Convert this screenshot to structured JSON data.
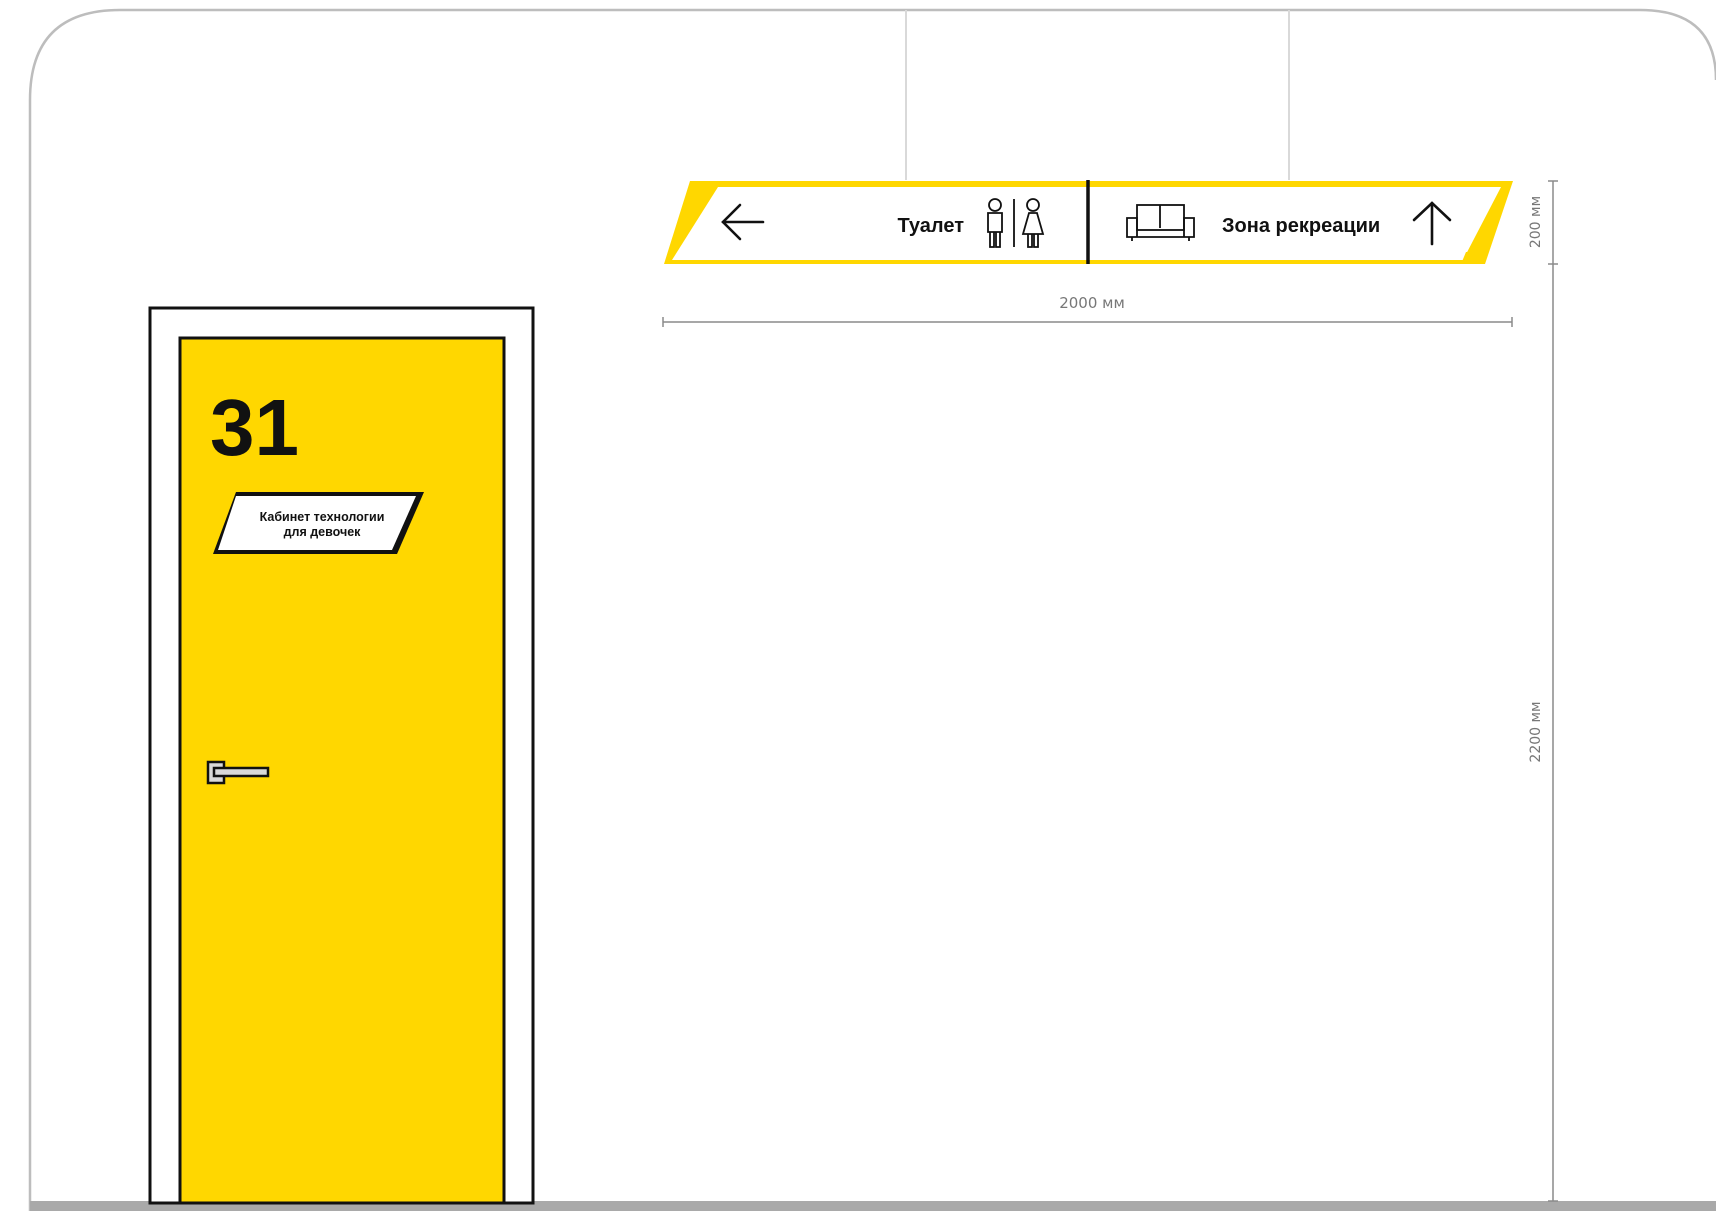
{
  "sign": {
    "toilet_label": "Туалет",
    "recreation_label": "Зона рекреации",
    "left_arrow_icon": "arrow-left-icon",
    "up_arrow_icon": "arrow-up-icon",
    "toilet_icon": "restroom-man-woman-icon",
    "sofa_icon": "sofa-icon"
  },
  "door": {
    "number": "31",
    "plate_line1": "Кабинет технологии",
    "plate_line2": "для девочек"
  },
  "dimensions": {
    "sign_width": "2000 мм",
    "sign_height": "200 мм",
    "mount_height": "2200 мм"
  },
  "colors": {
    "accent_yellow": "#FFD700",
    "outline": "#111111",
    "dimension_line": "#8a8a8a",
    "frame_border": "#bdbdbd",
    "floor": "#a9a9a9"
  }
}
